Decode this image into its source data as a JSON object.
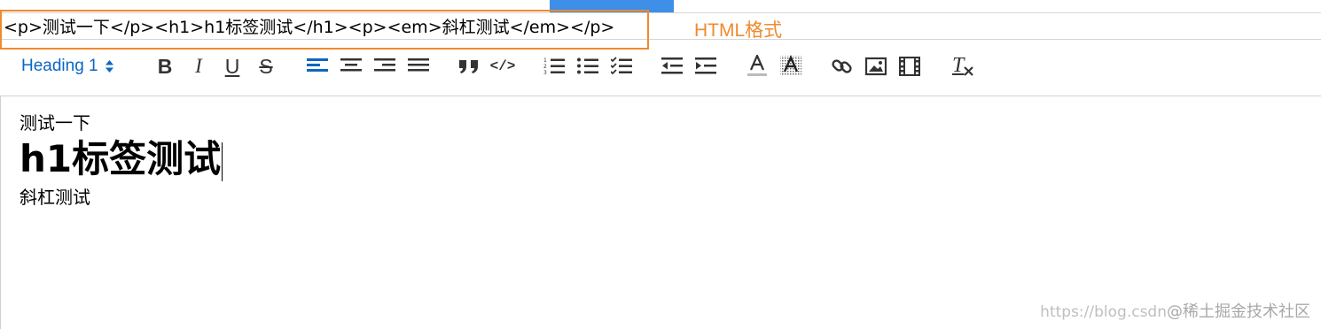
{
  "html_source": "<p>测试一下</p><h1>h1标签测试</h1><p><em>斜杠测试</em></p>",
  "html_label": "HTML格式",
  "toolbar": {
    "heading_select": "Heading 1",
    "bold": "B",
    "italic": "I",
    "underline": "U",
    "strike": "S",
    "code_label": "</>",
    "clear_label": "T"
  },
  "editor": {
    "paragraph1": "测试一下",
    "heading1": "h1标签测试",
    "paragraph2": "斜杠测试"
  },
  "watermark": {
    "url": "https://blog.csdn",
    "brand": "@稀土掘金技术社区"
  },
  "colors": {
    "accent": "#0b66c3",
    "annotation": "#f08a2d",
    "tab_indicator": "#3d8fe8"
  }
}
